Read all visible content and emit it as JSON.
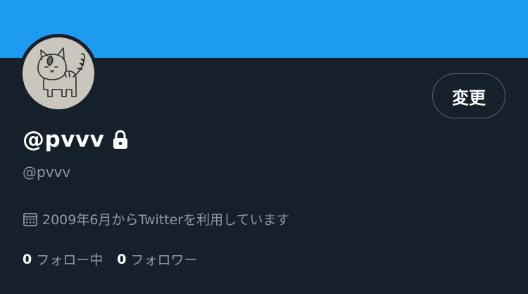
{
  "profile": {
    "display_name": "@pvvv",
    "handle": "@pvvv",
    "joined": "2009年6月からTwitterを利用しています",
    "edit_label": "変更",
    "protected_icon": "lock-icon",
    "calendar_icon": "calendar-icon",
    "avatar_description": "cat-drawing"
  },
  "stats": {
    "following_count": "0",
    "following_label": "フォロー中",
    "followers_count": "0",
    "followers_label": "フォロワー"
  },
  "colors": {
    "banner": "#1d9bf0",
    "background": "#15202b",
    "secondary_text": "#8b98a5",
    "border": "#536471"
  }
}
